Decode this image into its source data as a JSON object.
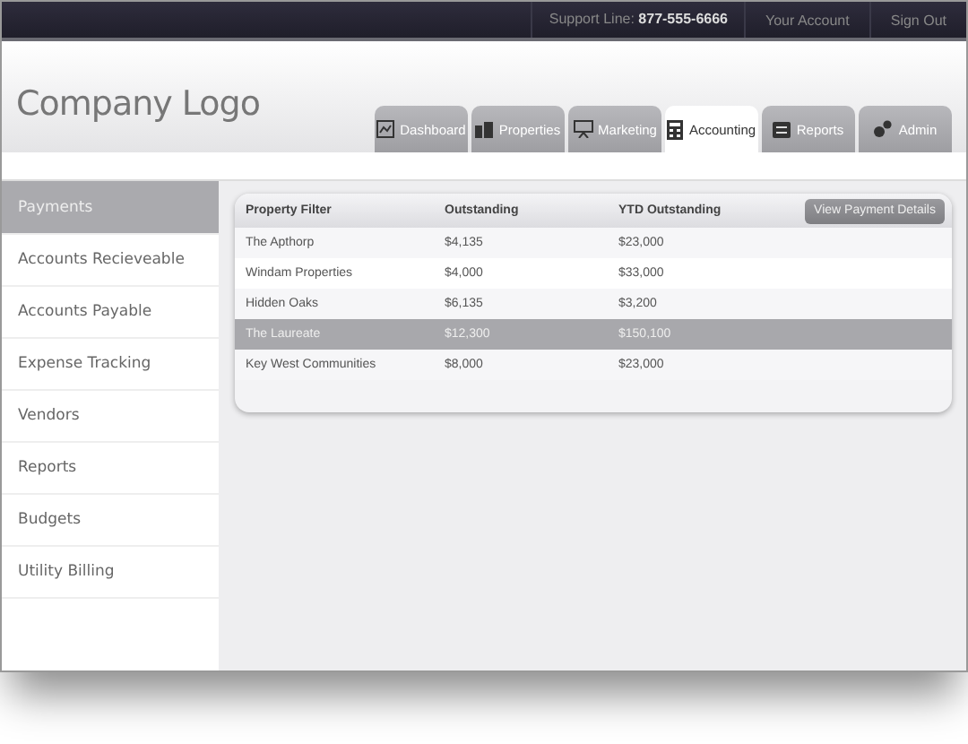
{
  "top_bar": {
    "support": "Support Line: **877-555-6666**",
    "links": [
      "Your Account",
      "Sign Out"
    ]
  },
  "header": {
    "logo": "Company Logo"
  },
  "tabs": [
    {
      "label": "Dashboard",
      "selected": false
    },
    {
      "label": "Properties",
      "selected": false
    },
    {
      "label": "Marketing",
      "selected": false
    },
    {
      "label": "Accounting",
      "selected": true
    },
    {
      "label": "Reports",
      "selected": false
    },
    {
      "label": "Admin",
      "selected": false
    }
  ],
  "sidebar": {
    "items": [
      {
        "label": "Payments",
        "selected": true
      },
      {
        "label": "Accounts Recieveable",
        "selected": false
      },
      {
        "label": "Accounts Payable",
        "selected": false
      },
      {
        "label": "Expense Tracking",
        "selected": false
      },
      {
        "label": "Vendors",
        "selected": false
      },
      {
        "label": "Reports",
        "selected": false
      },
      {
        "label": "Budgets",
        "selected": false
      },
      {
        "label": "Utility Billing",
        "selected": false
      }
    ]
  },
  "table": {
    "columns": [
      "Property Filter",
      "Outstanding",
      "YTD Outstanding"
    ],
    "button": "View Payment Details",
    "rows": [
      {
        "cells": [
          "The Apthorp",
          "$4,135",
          "$23,000"
        ],
        "selected": false
      },
      {
        "cells": [
          "Windam Properties",
          "$4,000",
          "$33,000"
        ],
        "selected": false
      },
      {
        "cells": [
          "Hidden Oaks",
          "$6,135",
          "$3,200"
        ],
        "selected": false
      },
      {
        "cells": [
          "The Laureate",
          "$12,300",
          "$150,100"
        ],
        "selected": true
      },
      {
        "cells": [
          "Key West Communities",
          "$8,000",
          "$23,000"
        ],
        "selected": false
      }
    ]
  }
}
